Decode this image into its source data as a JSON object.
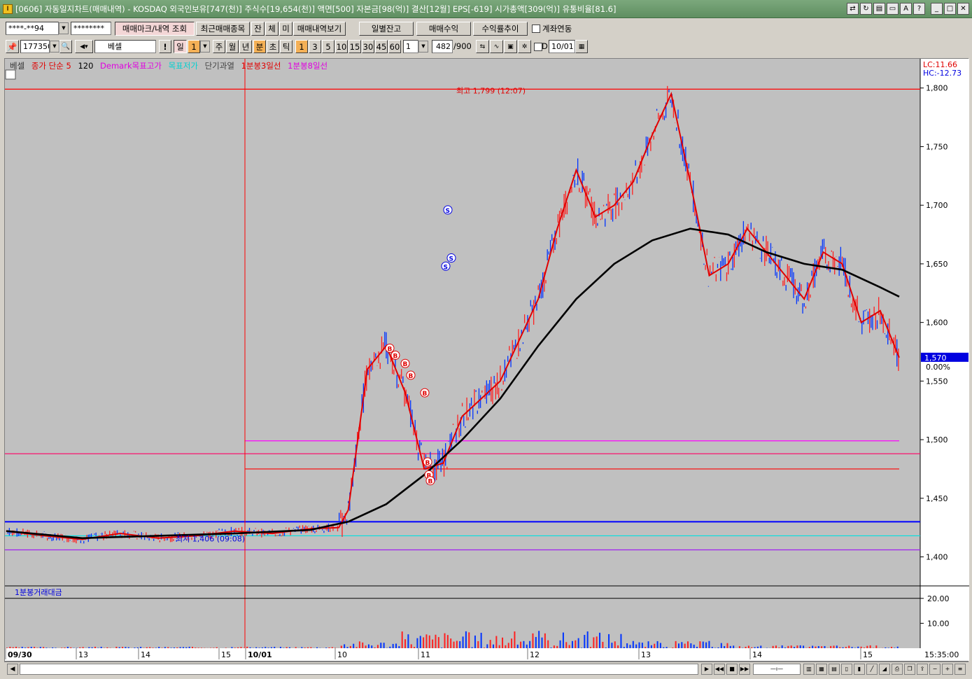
{
  "window": {
    "title": "[0606] 자동일지차트(매매내역) - KOSDAQ 외국인보유[747(천)] 주식수[19,654(천)] 액면[500] 자본금[98(억)] 결산[12월] EPS[-619] 시가총액[309(억)] 유통비율[81.6]",
    "icon_text": "I"
  },
  "toolbar1": {
    "account": "****-**94",
    "password": "********",
    "btn_view": "매매마크/내역 조회",
    "btn_recent": "최근매매종목",
    "btn_jan": "잔",
    "btn_che": "체",
    "btn_mi": "미",
    "btn_history": "매매내역보기",
    "btn_daily": "일별잔고",
    "btn_profit": "매매수익",
    "btn_rate": "수익률추이",
    "chk_link": "계좌연동"
  },
  "toolbar2": {
    "code": "177350",
    "name": "베셀",
    "p_day": "일",
    "p_day_n": "1",
    "p_week": "주",
    "p_month": "월",
    "p_year": "년",
    "p_min": "분",
    "p_sec": "초",
    "p_tick": "틱",
    "intervals": [
      "1",
      "3",
      "5",
      "10",
      "15",
      "30",
      "45",
      "60"
    ],
    "count": "1",
    "display": "482",
    "total": "/900",
    "chk_d": "D",
    "date": "10/01"
  },
  "legend": {
    "name": "베셀",
    "ma": "종가 단순 5",
    "ma120": "120",
    "demark_high": "Demark목표고가",
    "target": "목표저가",
    "short_over": "단기과열",
    "line3": "1분봉3일선",
    "line8": "1분봉8일선",
    "lc": "LC:11.66",
    "hc": "HC:-12.73"
  },
  "chart_data": [
    {
      "type": "line",
      "title": "",
      "x_tick_labels": [
        "09/30",
        "13",
        "14",
        "15",
        "10/01",
        "10",
        "11",
        "12",
        "13",
        "14",
        "15"
      ],
      "y_ticks": [
        1800,
        1750,
        1700,
        1650,
        1600,
        1550,
        1500,
        1450,
        1400
      ],
      "ylim": [
        1386,
        1807
      ],
      "series": [
        {
          "name": "종가 단순 5",
          "color": "#e00000",
          "x": [
            0,
            20,
            40,
            60,
            80,
            100,
            120,
            140,
            160,
            175,
            180,
            190,
            200,
            210,
            220,
            230,
            240,
            260,
            280,
            290,
            300,
            310,
            320,
            330,
            340,
            350,
            360,
            370,
            380,
            390,
            400,
            410,
            420,
            430,
            440,
            450,
            460,
            470
          ],
          "values": [
            1422,
            1418,
            1415,
            1420,
            1416,
            1418,
            1422,
            1420,
            1424,
            1425,
            1440,
            1560,
            1580,
            1540,
            1475,
            1480,
            1520,
            1550,
            1620,
            1680,
            1730,
            1690,
            1700,
            1720,
            1760,
            1795,
            1720,
            1640,
            1650,
            1680,
            1660,
            1640,
            1620,
            1660,
            1650,
            1600,
            1610,
            1570
          ]
        },
        {
          "name": "120",
          "color": "#000000",
          "x": [
            0,
            40,
            80,
            120,
            160,
            180,
            200,
            220,
            240,
            260,
            280,
            300,
            320,
            340,
            360,
            380,
            400,
            420,
            440,
            460,
            470
          ],
          "values": [
            1422,
            1416,
            1418,
            1420,
            1423,
            1430,
            1445,
            1470,
            1500,
            1535,
            1580,
            1620,
            1650,
            1670,
            1680,
            1675,
            1660,
            1650,
            1645,
            1630,
            1622
          ]
        }
      ],
      "h_lines": [
        {
          "value": 1799,
          "color": "#ff0000"
        },
        {
          "value": 1499,
          "color": "#ff00ff"
        },
        {
          "value": 1488,
          "color": "#ff0066"
        },
        {
          "value": 1475,
          "color": "#ff0000"
        },
        {
          "value": 1430,
          "color": "#0000ff"
        },
        {
          "value": 1418,
          "color": "#00e0e0"
        },
        {
          "value": 1406,
          "color": "#a020f0"
        }
      ],
      "annotations": [
        {
          "text": "최고 1,799 (12:07)",
          "value": 1799
        },
        {
          "text": "최저 1,406 (09:08)",
          "value": 1406
        }
      ],
      "price_label": "1,570",
      "change_label": "0.00%",
      "buy_marks": [
        1578,
        1572,
        1565,
        1555,
        1540,
        1481,
        1470,
        1465
      ],
      "sell_marks": [
        1696,
        1648,
        1655
      ]
    },
    {
      "type": "bar",
      "title": "1분봉거래대금",
      "y_ticks": [
        "20.00",
        "10.00"
      ],
      "ylim": [
        0,
        25
      ],
      "time_label": "15:35:00"
    }
  ],
  "colors": {
    "chart_bg": "#c0c0c0",
    "up": "#ff0000",
    "down": "#0000ff",
    "title_bar": "#6a9a6c"
  },
  "status": {
    "scroll_label": ""
  }
}
